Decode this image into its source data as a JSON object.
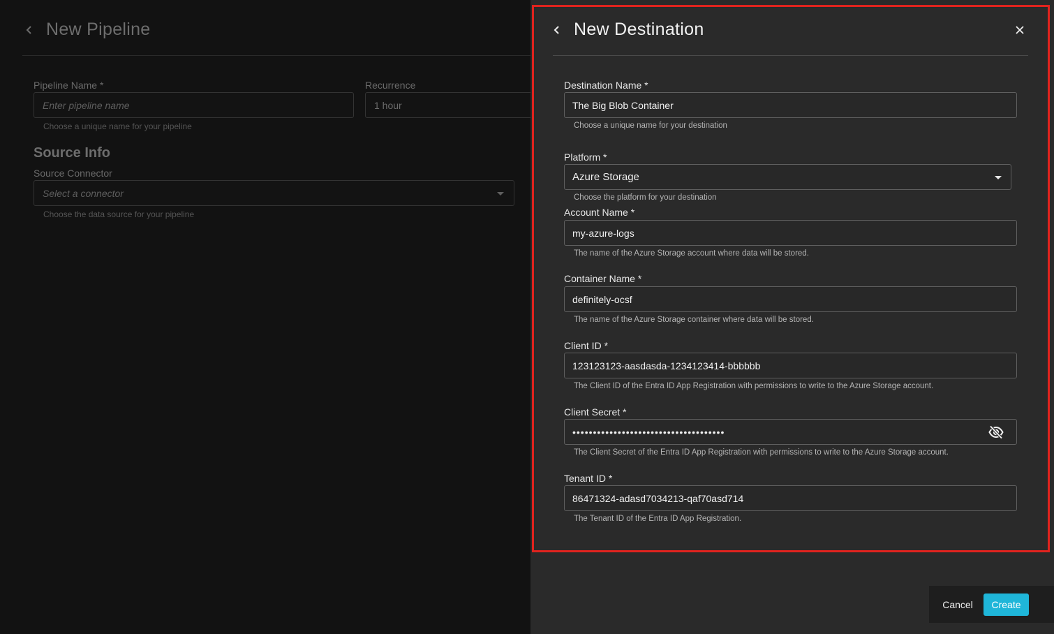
{
  "pipeline_page": {
    "title": "New Pipeline",
    "pipeline_name": {
      "label": "Pipeline Name *",
      "placeholder": "Enter pipeline name",
      "help": "Choose a unique name for your pipeline"
    },
    "recurrence": {
      "label": "Recurrence",
      "value": "1 hour"
    },
    "source_info": {
      "heading": "Source Info",
      "connector_label": "Source Connector",
      "connector_placeholder": "Select a connector",
      "connector_help": "Choose the data source for your pipeline"
    }
  },
  "drawer": {
    "title": "New Destination",
    "fields": {
      "destination_name": {
        "label": "Destination Name *",
        "value": "The Big Blob Container",
        "help": "Choose a unique name for your destination"
      },
      "platform": {
        "label": "Platform *",
        "value": "Azure Storage",
        "help": "Choose the platform for your destination"
      },
      "account_name": {
        "label": "Account Name *",
        "value": "my-azure-logs",
        "help": "The name of the Azure Storage account where data will be stored."
      },
      "container_name": {
        "label": "Container Name *",
        "value": "definitely-ocsf",
        "help": "The name of the Azure Storage container where data will be stored."
      },
      "client_id": {
        "label": "Client ID *",
        "value": "123123123-aasdasda-1234123414-bbbbbb",
        "help": "The Client ID of the Entra ID App Registration with permissions to write to the Azure Storage account."
      },
      "client_secret": {
        "label": "Client Secret *",
        "value": "•••••••••••••••••••••••••••••••••••••",
        "help": "The Client Secret of the Entra ID App Registration with permissions to write to the Azure Storage account."
      },
      "tenant_id": {
        "label": "Tenant ID *",
        "value": "86471324-adasd7034213-qaf70asd714",
        "help": "The Tenant ID of the Entra ID App Registration."
      }
    }
  },
  "footer": {
    "cancel_label": "Cancel",
    "create_label": "Create"
  },
  "colors": {
    "accent": "#1fb6d9",
    "highlight": "#e0231e",
    "drawer_bg": "#2a2a2a",
    "page_bg": "#121212"
  },
  "icons": {
    "back": "chevron-left-icon",
    "close": "close-icon",
    "visibility": "eye-off-icon",
    "dropdown": "caret-down-icon"
  }
}
